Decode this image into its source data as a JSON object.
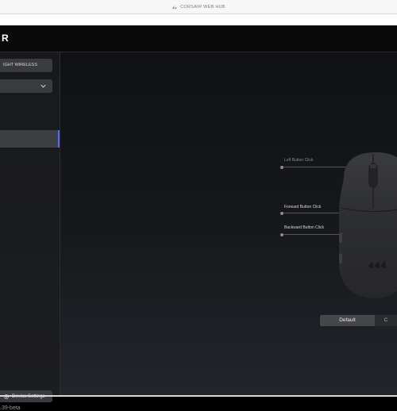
{
  "window": {
    "title": "CORSAIR WEB HUB"
  },
  "header": {
    "brand": "R"
  },
  "sidebar": {
    "device_button": "IGHT WIRELESS",
    "settings_button": "Device Settings",
    "version": ".39-beta"
  },
  "mappings": {
    "left": "Left Button Click",
    "forward": "Forward Button Click",
    "backward": "Backward Button Click"
  },
  "segmented": {
    "default": "Default",
    "second": "C"
  },
  "colors": {
    "accent": "#5468ff"
  }
}
